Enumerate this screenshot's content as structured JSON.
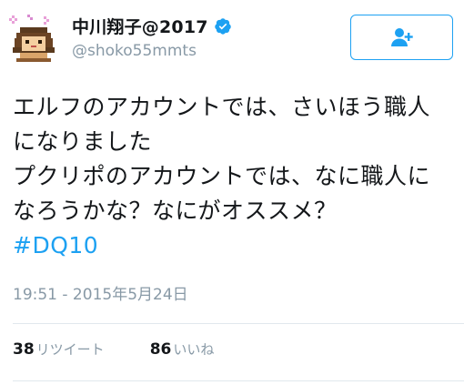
{
  "user": {
    "display_name": "中川翔子@2017",
    "handle": "@shoko55mmts",
    "verified": true
  },
  "tweet": {
    "lines": [
      "エルフのアカウントでは、さいほう職人",
      "になりました",
      "プクリポのアカウントでは、なに職人に",
      "なろうかな？なにがオススメ？"
    ],
    "hashtag": "#DQ10",
    "timestamp": "19:51 - 2015年5月24日"
  },
  "stats": {
    "retweets_count": "38",
    "retweets_label": "リツイート",
    "likes_count": "86",
    "likes_label": "いいね"
  },
  "icons": {
    "follow": "add-user-icon",
    "verified": "verified-badge-icon"
  },
  "colors": {
    "accent": "#1da1f2",
    "secondary_text": "#8899a6",
    "text": "#14171a"
  }
}
